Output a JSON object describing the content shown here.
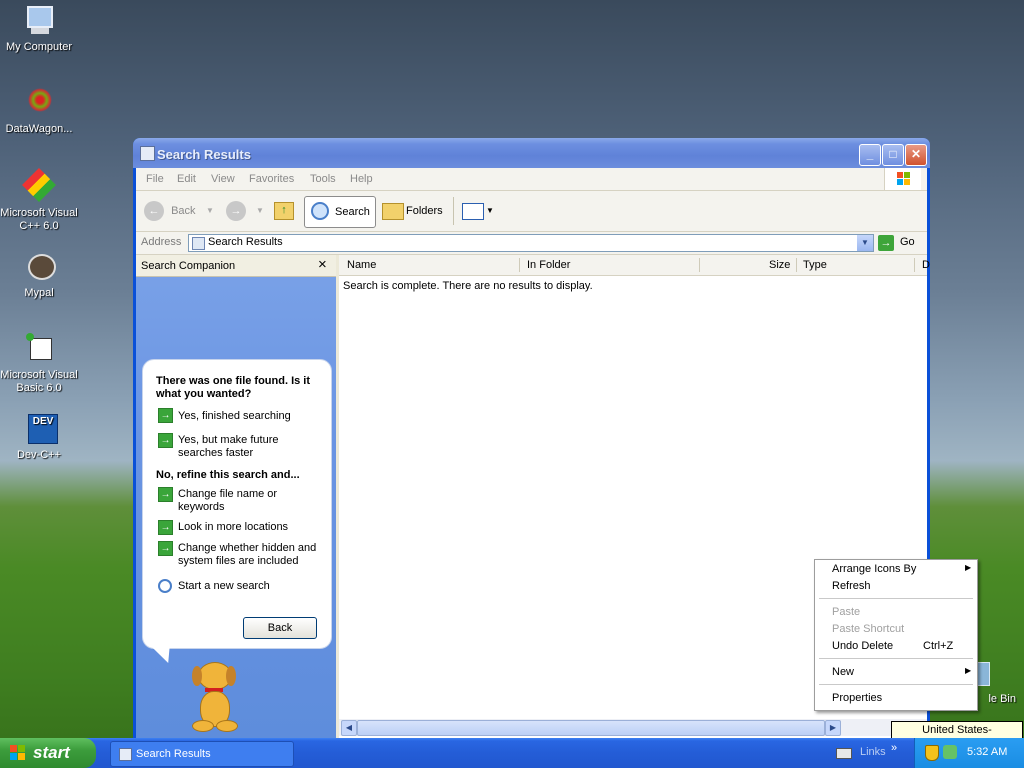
{
  "desktop": {
    "icons": [
      {
        "label": "My Computer"
      },
      {
        "label": "DataWagon..."
      },
      {
        "label": "Microsoft Visual C++ 6.0"
      },
      {
        "label": "Mypal"
      },
      {
        "label": "Microsoft Visual Basic 6.0"
      },
      {
        "label": "Dev-C++"
      },
      {
        "label": "le Bin"
      }
    ]
  },
  "window": {
    "title": "Search Results",
    "menu": [
      "File",
      "Edit",
      "View",
      "Favorites",
      "Tools",
      "Help"
    ],
    "toolbar": {
      "back_label": "Back",
      "search_label": "Search",
      "folders_label": "Folders"
    },
    "address": {
      "label": "Address",
      "value": "Search Results",
      "go_label": "Go"
    },
    "companion": {
      "title": "Search Companion",
      "close_glyph": "×",
      "question": "There was one file found.  Is it what you wanted?",
      "yes_finished": "Yes, finished searching",
      "yes_future": "Yes, but make future searches faster",
      "refine_heading": "No, refine this search and...",
      "refine_options": [
        "Change file name or keywords",
        "Look in more locations",
        "Change whether hidden and system files are included"
      ],
      "new_search": "Start a new search",
      "back_button": "Back"
    },
    "results": {
      "columns": [
        "Name",
        "In Folder",
        "Size",
        "Type",
        "D"
      ],
      "status": "Search is complete. There are no results to display."
    }
  },
  "context_menu": {
    "arrange": "Arrange Icons By",
    "refresh": "Refresh",
    "paste": "Paste",
    "paste_shortcut": "Paste Shortcut",
    "undo_delete": "Undo Delete",
    "undo_shortcut": "Ctrl+Z",
    "new": "New",
    "properties": "Properties"
  },
  "tooltip": "United States-International",
  "taskbar": {
    "start_label": "start",
    "task_item": "Search Results",
    "links_label": "Links",
    "chevron": "»",
    "clock": "5:32 AM"
  }
}
